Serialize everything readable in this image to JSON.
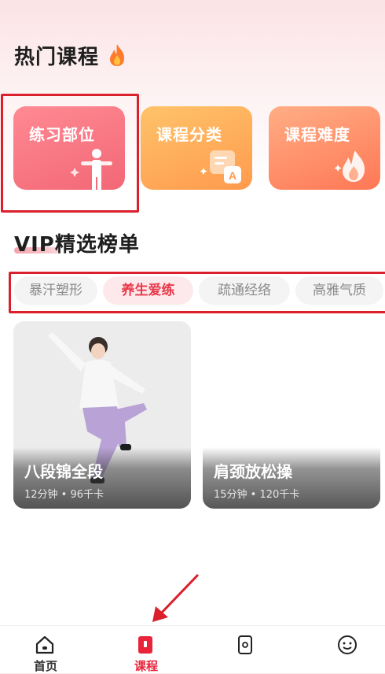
{
  "hot_courses": {
    "title": "热门课程",
    "cards": [
      {
        "label": "练习部位",
        "icon": "person-stretch-icon"
      },
      {
        "label": "课程分类",
        "icon": "category-chat-icon"
      },
      {
        "label": "课程难度",
        "icon": "flame-icon"
      }
    ]
  },
  "vip": {
    "title": "VIP精选榜单",
    "tabs": [
      {
        "label": "暴汗塑形",
        "active": false
      },
      {
        "label": "养生爱练",
        "active": true
      },
      {
        "label": "疏通经络",
        "active": false
      },
      {
        "label": "高雅气质",
        "active": false
      }
    ],
    "courses": [
      {
        "title": "八段锦全段",
        "meta": "12分钟 • 96千卡"
      },
      {
        "title": "肩颈放松操",
        "meta": "15分钟 • 120千卡"
      }
    ]
  },
  "bottom_nav": [
    {
      "label": "首页",
      "icon": "home-icon",
      "active": false
    },
    {
      "label": "课程",
      "icon": "course-book-icon",
      "active": true
    },
    {
      "label": "",
      "icon": "phone-icon",
      "active": false
    },
    {
      "label": "",
      "icon": "smile-icon",
      "active": false
    }
  ],
  "colors": {
    "accent": "#e8233a",
    "highlight_box": "#d9202b"
  }
}
